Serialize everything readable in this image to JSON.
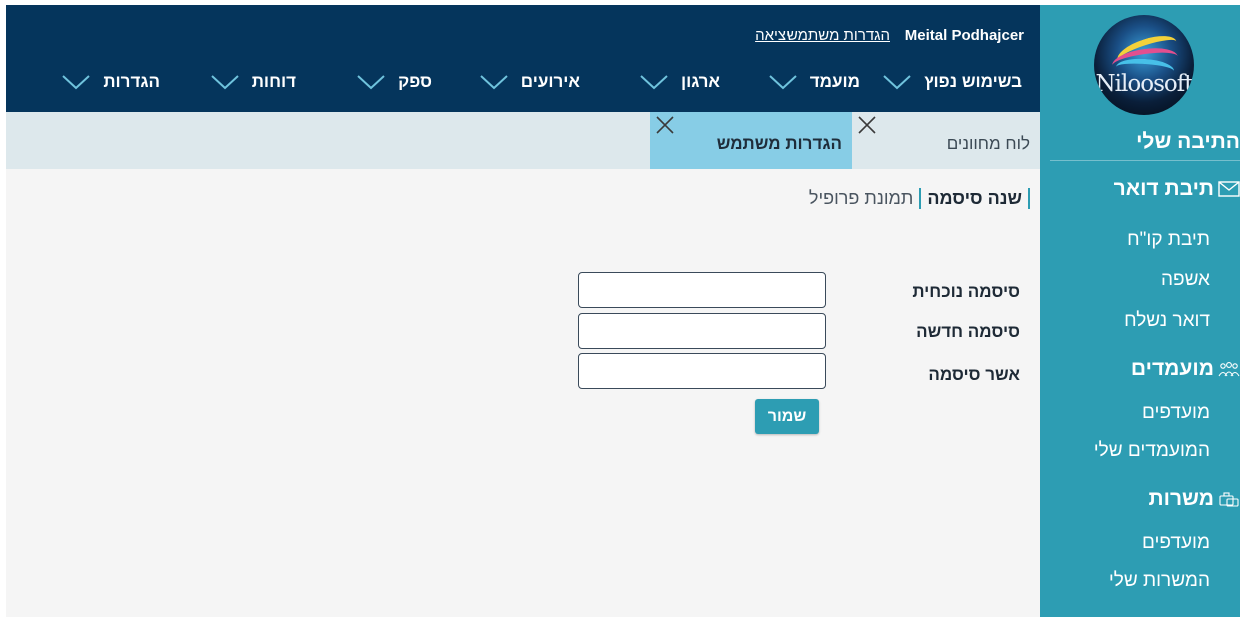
{
  "header": {
    "user_name": "Meital Podhajcer",
    "links": {
      "user_settings": "הגדרות משתמש",
      "logout": "יציאה"
    },
    "nav": [
      {
        "label": "בשימוש נפוץ"
      },
      {
        "label": "מועמד"
      },
      {
        "label": "ארגון"
      },
      {
        "label": "אירועים"
      },
      {
        "label": "ספק"
      },
      {
        "label": "דוחות"
      },
      {
        "label": "הגדרות"
      }
    ]
  },
  "tabs": [
    {
      "label": "לוח מחוונים"
    },
    {
      "label": "הגדרות משתמש",
      "active": true
    }
  ],
  "subtabs": {
    "password": "שנה סיסמה",
    "profile_photo": "תמונת פרופיל",
    "active": "password"
  },
  "form": {
    "current_password": {
      "label": "סיסמה נוכחית",
      "value": ""
    },
    "new_password": {
      "label": "סיסמה חדשה",
      "value": ""
    },
    "confirm_password": {
      "label": "אשר סיסמה",
      "value": ""
    },
    "save_label": "שמור"
  },
  "sidebar": {
    "logo_text": "Niloosoft",
    "title": "התיבה שלי",
    "mailbox": {
      "title": "תיבת דואר",
      "icon": "envelope-icon",
      "items": [
        "תיבת קו\"ח",
        "אשפה",
        "דואר נשלח"
      ]
    },
    "candidates": {
      "title": "מועמדים",
      "icon": "people-icon",
      "items": [
        "מועדפים",
        "המועמדים שלי"
      ]
    },
    "jobs": {
      "title": "משרות",
      "icon": "briefcase-icon",
      "items": [
        "מועדפים",
        "המשרות שלי"
      ]
    }
  },
  "colors": {
    "header": "#05355c",
    "sidebar": "#2d9db3",
    "active_tab": "#87cde6",
    "tabbar": "#dde8ec",
    "accent": "#2d9db3"
  }
}
